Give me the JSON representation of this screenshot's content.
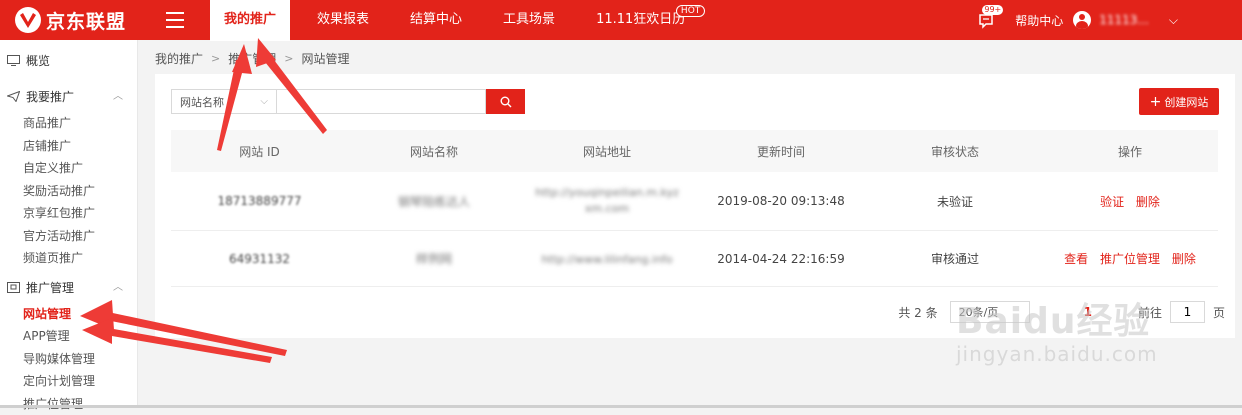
{
  "brand": {
    "name": "京东联盟"
  },
  "topnav": {
    "items": [
      {
        "label": "我的推广"
      },
      {
        "label": "效果报表"
      },
      {
        "label": "结算中心"
      },
      {
        "label": "工具场景"
      },
      {
        "label": "11.11狂欢日历"
      }
    ],
    "hot_badge": "HOT",
    "message_count": "99+",
    "help_label": "帮助中心",
    "username": "11113..."
  },
  "sidebar": {
    "overview": "概览",
    "promote_group": "我要推广",
    "promote_items": [
      "商品推广",
      "店铺推广",
      "自定义推广",
      "奖励活动推广",
      "京享红包推广",
      "官方活动推广",
      "频道页推广"
    ],
    "manage_group": "推广管理",
    "manage_items": [
      "网站管理",
      "APP管理",
      "导购媒体管理",
      "定向计划管理",
      "推广位管理"
    ]
  },
  "breadcrumb": [
    "我的推广",
    "推广管理",
    "网站管理"
  ],
  "search": {
    "field_select": "网站名称",
    "placeholder": ""
  },
  "create_button": "创建网站",
  "table": {
    "columns": [
      "网站 ID",
      "网站名称",
      "网站地址",
      "更新时间",
      "审核状态",
      "操作"
    ],
    "rows": [
      {
        "id": "18713889777",
        "name": "钢琴陪练达人",
        "url": "http://youqinpeilian.m.kyzxm.com",
        "updated": "2019-08-20 09:13:48",
        "status": "未验证",
        "actions": [
          "验证",
          "删除"
        ]
      },
      {
        "id": "64931132",
        "name": "样例网",
        "url": "http://www.lilinfang.info",
        "updated": "2014-04-24 22:16:59",
        "status": "审核通过",
        "actions": [
          "查看",
          "推广位管理",
          "删除"
        ]
      }
    ]
  },
  "pagination": {
    "total": "共 2 条",
    "page_size": "20条/页",
    "current_page": "1",
    "goto_label": "前往",
    "goto_value": "1",
    "page_suffix": "页"
  },
  "watermark": {
    "main": "Baidu经验",
    "sub": "jingyan.baidu.com"
  },
  "colors": {
    "brand_red": "#e2231a",
    "annotation_red": "#ee3b36"
  }
}
